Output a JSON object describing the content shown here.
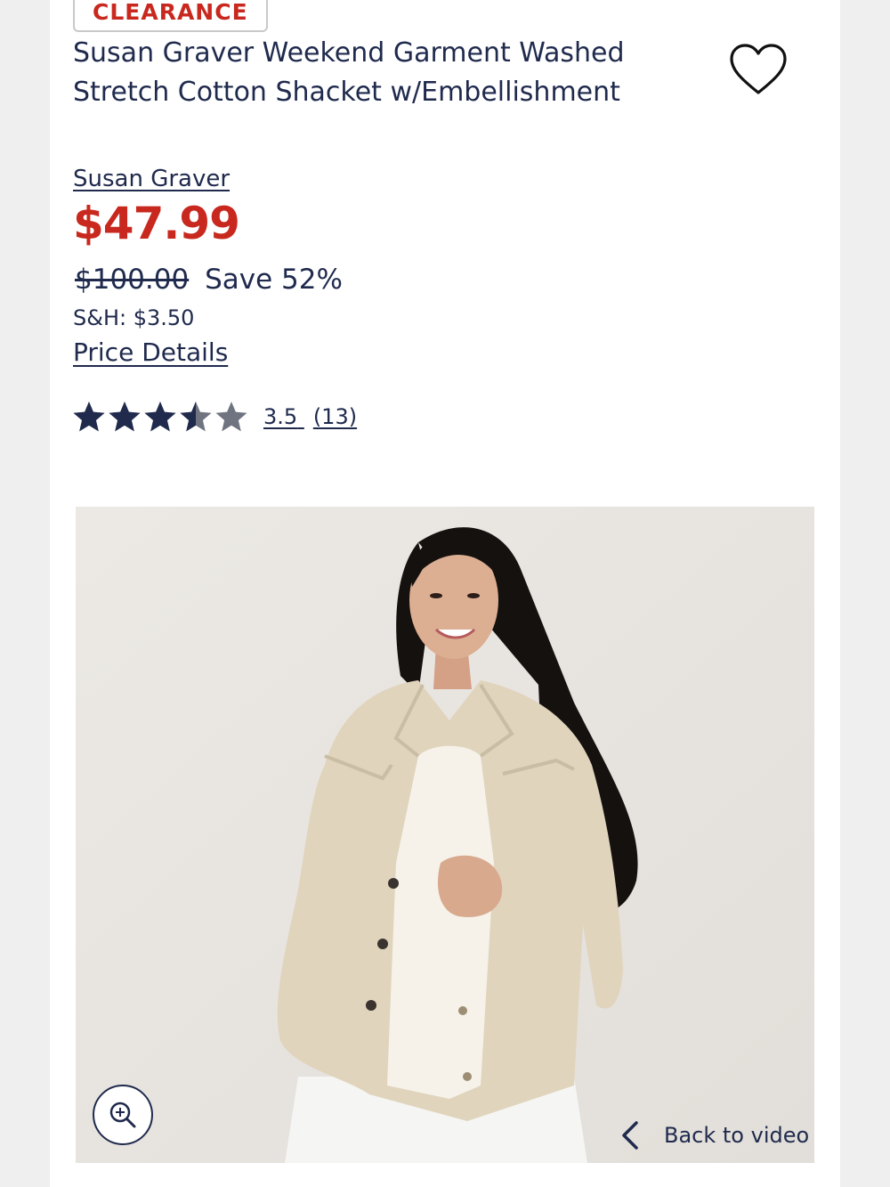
{
  "product": {
    "badge": "CLEARANCE",
    "title": "Susan Graver Weekend Garment Washed Stretch Cotton Shacket w/Embellishment",
    "brand": "Susan Graver",
    "price": "$47.99",
    "was_price": "$100.00",
    "savings": "Save 52%",
    "shipping": "S&H: $3.50",
    "price_details_link": "Price Details"
  },
  "rating": {
    "value": 3.5,
    "max": 5,
    "score_label": "3.5",
    "count_label": "(13)"
  },
  "media": {
    "zoom_icon": "zoom-in-icon",
    "back_to_video_label": "Back to video",
    "back_icon": "chevron-left-icon"
  },
  "icons": {
    "wishlist": "heart-icon",
    "star": "star-icon"
  },
  "colors": {
    "sale_red": "#c8281e",
    "navy": "#1f2a4d",
    "star_filled": "#1f2a4d",
    "star_empty": "#6f7480"
  }
}
